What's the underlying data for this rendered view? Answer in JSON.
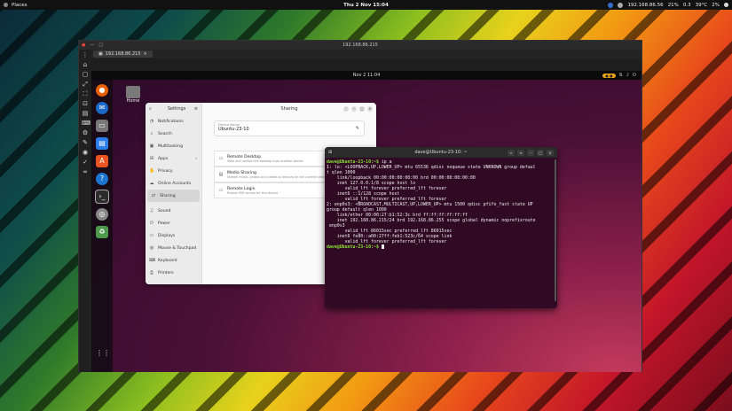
{
  "topbar": {
    "places": "Places",
    "clock": "Thu 2 Nov 15:04",
    "ip": "192.168.86.56",
    "battery": "21%",
    "net": "0.3",
    "temp": "39°C",
    "disk": "2%"
  },
  "host": {
    "title": "192.168.86.215",
    "tab": "192.168.86.215"
  },
  "guest": {
    "clock": "Nov 2  11:04",
    "home_label": "Home"
  },
  "settings": {
    "title": "Settings",
    "panel_title": "Sharing",
    "sidebar": [
      "Notifications",
      "Search",
      "Multitasking",
      "Apps",
      "Privacy",
      "Online Accounts",
      "Sharing",
      "Sound",
      "Power",
      "Displays",
      "Mouse & Touchpad",
      "Keyboard",
      "Printers"
    ],
    "device_name_label": "Device Name",
    "device_name": "Ubuntu-23-10",
    "options": [
      {
        "title": "Remote Desktop",
        "desc": "View and control this desktop from another device"
      },
      {
        "title": "Media Sharing",
        "desc": "Stream music, photos and videos to devices on the current network"
      },
      {
        "title": "Remote Login",
        "desc": "Enable SSH access for this device"
      }
    ]
  },
  "terminal": {
    "title": "dave@Ubuntu-23-10: ~",
    "prompt": "dave@Ubuntu-23-10:~$",
    "command": " ip a",
    "output": "1: lo: <LOOPBACK,UP,LOWER_UP> mtu 65536 qdisc noqueue state UNKNOWN group defaul\nt qlen 1000\n    link/loopback 00:00:00:00:00:00 brd 00:00:00:00:00:00\n    inet 127.0.0.1/8 scope host lo\n       valid_lft forever preferred_lft forever\n    inet6 ::1/128 scope host\n       valid_lft forever preferred_lft forever\n2: enp0s3: <BROADCAST,MULTICAST,UP,LOWER_UP> mtu 1500 qdisc pfifo_fast state UP\ngroup default qlen 1000\n    link/ether 00:00:27:b1:52:3c brd ff:ff:ff:ff:ff:ff\n    inet 192.168.86.215/24 brd 192.168.86.255 scope global dynamic noprefixroute\n enp0s3\n       valid_lft 86015sec preferred_lft 86015sec\n    inet6 fe80::a00:27ff:feb1:523c/64 scope link\n       valid_lft forever preferred_lft forever",
    "prompt2": "dave@Ubuntu-23-10:~$"
  }
}
